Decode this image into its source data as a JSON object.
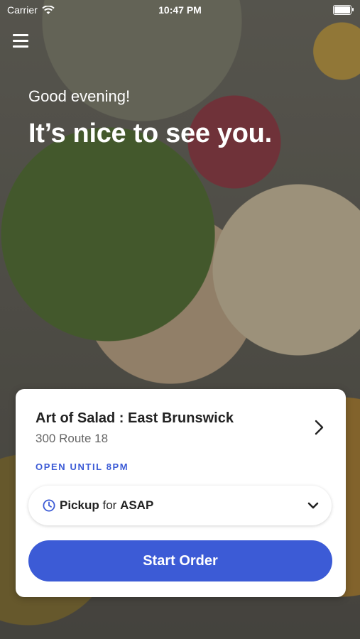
{
  "status_bar": {
    "carrier": "Carrier",
    "time": "10:47 PM"
  },
  "header": {
    "greeting": "Good evening!",
    "headline": "It’s nice to see you."
  },
  "store": {
    "name": "Art of Salad : East Brunswick",
    "address": "300 Route 18",
    "hours": "OPEN UNTIL 8PM"
  },
  "order_mode": {
    "method": "Pickup",
    "connector": "for",
    "time": "ASAP"
  },
  "start_button": {
    "label": "Start Order"
  },
  "colors": {
    "accent": "#3c5bd6",
    "card": "#ffffff",
    "text": "#222222"
  },
  "icons": [
    "menu-icon",
    "wifi-icon",
    "battery-icon",
    "chevron-right-icon",
    "clock-icon",
    "chevron-down-icon"
  ]
}
